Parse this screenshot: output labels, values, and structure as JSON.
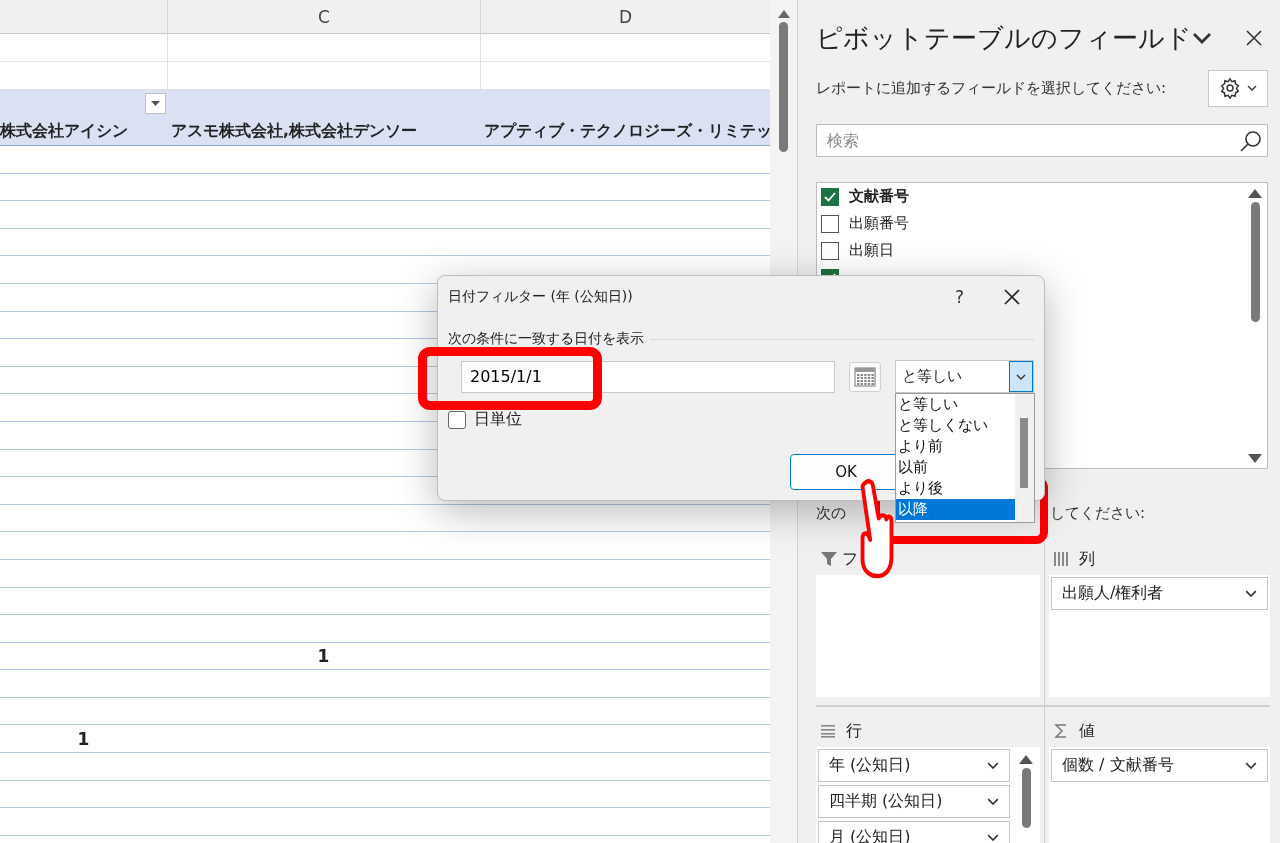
{
  "sheet": {
    "columns": [
      "C",
      "D"
    ],
    "header_cells": [
      "株式会社アイシン",
      "アスモ株式会社,株式会社デンソー",
      "アプティブ・テクノロジーズ・リミテッ"
    ],
    "rows": [
      {},
      {},
      {},
      {},
      {},
      {},
      {},
      {},
      {},
      {},
      {},
      {},
      {},
      {},
      {},
      {},
      {},
      {},
      {
        "c": "1"
      },
      {},
      {},
      {
        "b": "1"
      },
      {},
      {},
      {}
    ]
  },
  "dialog": {
    "title": "日付フィルター (年 (公知日))",
    "help": "?",
    "group_label": "次の条件に一致する日付を表示",
    "date_value": "2015/1/1",
    "operator": "と等しい",
    "options": [
      {
        "label": "と等しい",
        "selected": false
      },
      {
        "label": "と等しくない",
        "selected": false
      },
      {
        "label": "より前",
        "selected": false
      },
      {
        "label": "以前",
        "selected": false
      },
      {
        "label": "より後",
        "selected": false
      },
      {
        "label": "以降",
        "selected": true
      }
    ],
    "day_unit": {
      "label": "日単位",
      "checked": false
    },
    "ok": "OK"
  },
  "pane": {
    "title": "ピボットテーブルのフィールド",
    "subtitle": "レポートに追加するフィールドを選択してください:",
    "search": {
      "placeholder": "検索"
    },
    "fields": [
      {
        "label": "文献番号",
        "checked": true
      },
      {
        "label": "出願番号",
        "checked": false
      },
      {
        "label": "出願日",
        "checked": false
      },
      {
        "checked": true
      }
    ],
    "drag_hint": [
      "次の",
      "してください:"
    ],
    "areas": [
      {
        "kind": "filter",
        "label": "フ"
      },
      {
        "kind": "columns",
        "label": "列",
        "items": [
          "出願人/権利者"
        ]
      },
      {
        "kind": "rows",
        "label": "行",
        "items": [
          "年 (公知日)",
          "四半期 (公知日)",
          "月 (公知日)"
        ]
      },
      {
        "kind": "values",
        "label": "値",
        "items": [
          "個数 / 文献番号"
        ]
      }
    ]
  }
}
